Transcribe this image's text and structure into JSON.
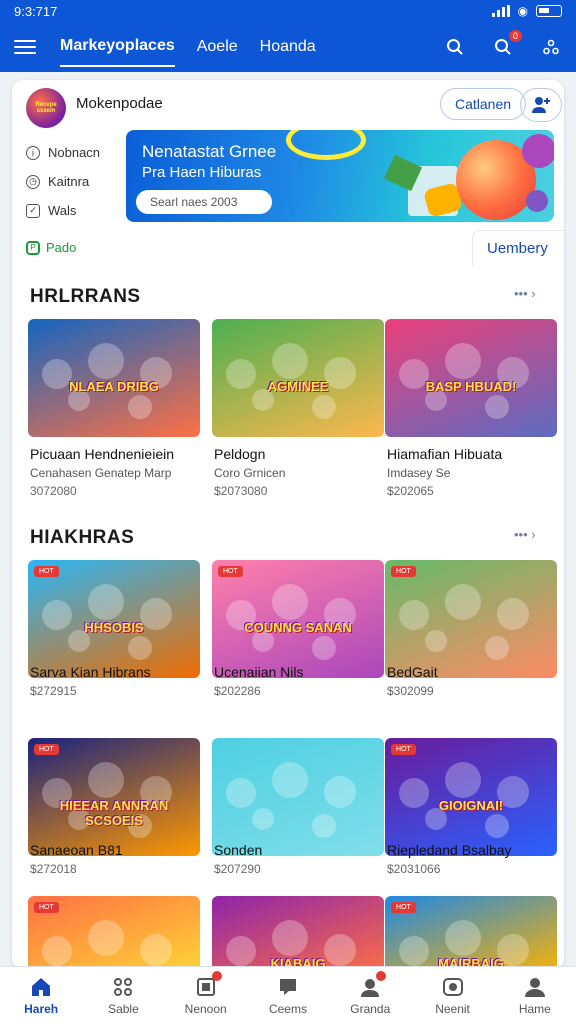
{
  "status": {
    "time": "9:3:717"
  },
  "topnav": {
    "tabs": [
      "Markeyoplaces",
      "Aoele",
      "Hoanda"
    ],
    "badge": "0"
  },
  "merchant": {
    "logo_text": "Recepe sssem",
    "name": "Mokenpodae",
    "category_button": "Catlanen"
  },
  "side_menu": [
    {
      "label": "Nobnacn",
      "icon": "info-icon"
    },
    {
      "label": "Kaitnra",
      "icon": "clock-icon"
    },
    {
      "label": "Wals",
      "icon": "check-icon"
    }
  ],
  "banner": {
    "line1": "Nenatastat Grnee",
    "line2": "Pra Haen Hiburas",
    "field_text": "Searl naes 2003"
  },
  "pado_label": "Pado",
  "uembery_label": "Uembery",
  "section1": {
    "title": "HRLRRANS",
    "more": "•••",
    "games": [
      {
        "name": "Picuaan Hendnenieiein",
        "sub": "Cenahasen Genatep Marp",
        "price": "3072080",
        "art": "NLAEA DRIBG",
        "colors": [
          "#1565c0",
          "#ff7043"
        ]
      },
      {
        "name": "Peldogn",
        "sub": "Coro Grnicen",
        "price": "$2073080",
        "art": "AGMINEE",
        "colors": [
          "#4caf50",
          "#ffb74d"
        ]
      },
      {
        "name": "Hiamafian Hibuata",
        "sub": "Imdasey Se",
        "price": "$202065",
        "art": "BASP HBUAD!",
        "colors": [
          "#ec407a",
          "#5c6bc0"
        ]
      }
    ]
  },
  "section2": {
    "title": "HIAKHRAS",
    "more": "•••",
    "rows": [
      [
        {
          "name": "Sarva Kian Hibrans",
          "price": "$272915",
          "art": "HHSOBIS",
          "tag": "HOT",
          "colors": [
            "#29b6f6",
            "#ef6c00"
          ]
        },
        {
          "name": "Ucenaiian Nils",
          "price": "$202286",
          "art": "COUNNG SANAN",
          "tag": "HOT",
          "colors": [
            "#ff80ab",
            "#ab47bc"
          ]
        },
        {
          "name": "BedGait",
          "price": "$302099",
          "art": "",
          "tag": "HOT",
          "colors": [
            "#66bb6a",
            "#ff8a65"
          ]
        }
      ],
      [
        {
          "name": "Sanaeoan B81",
          "price": "$272018",
          "art": "HIEEAR ANNRAN SCSOEIS",
          "tag": "HOT",
          "colors": [
            "#1a237e",
            "#ff9800"
          ]
        },
        {
          "name": "Sonden",
          "price": "$207290",
          "art": "",
          "tag": "",
          "colors": [
            "#4dd0e1",
            "#80deea"
          ]
        },
        {
          "name": "Riepledand Bsalbay",
          "price": "$2031066",
          "art": "GIOIGNAI!",
          "tag": "HOT",
          "colors": [
            "#6a1b9a",
            "#2962ff"
          ]
        }
      ],
      [
        {
          "name": "",
          "price": "",
          "art": "",
          "tag": "HOT",
          "colors": [
            "#ff7043",
            "#fdd835"
          ]
        },
        {
          "name": "",
          "price": "",
          "art": "KIABAIG",
          "tag": "",
          "colors": [
            "#8e24aa",
            "#ff7043"
          ]
        },
        {
          "name": "",
          "price": "",
          "art": "MAIRBAIG",
          "tag": "HOT",
          "colors": [
            "#1e88e5",
            "#ffb300"
          ]
        }
      ]
    ]
  },
  "bottom_nav": [
    {
      "label": "Hareh",
      "icon": "home-icon",
      "active": true,
      "badge": false
    },
    {
      "label": "Sable",
      "icon": "apps-icon",
      "active": false,
      "badge": false
    },
    {
      "label": "Nenoon",
      "icon": "bookmark-icon",
      "active": false,
      "badge": true
    },
    {
      "label": "Ceems",
      "icon": "chat-icon",
      "active": false,
      "badge": false
    },
    {
      "label": "Granda",
      "icon": "person-group-icon",
      "active": false,
      "badge": true
    },
    {
      "label": "Neenit",
      "icon": "camera-icon",
      "active": false,
      "badge": false
    },
    {
      "label": "Hame",
      "icon": "account-icon",
      "active": false,
      "badge": false
    }
  ]
}
